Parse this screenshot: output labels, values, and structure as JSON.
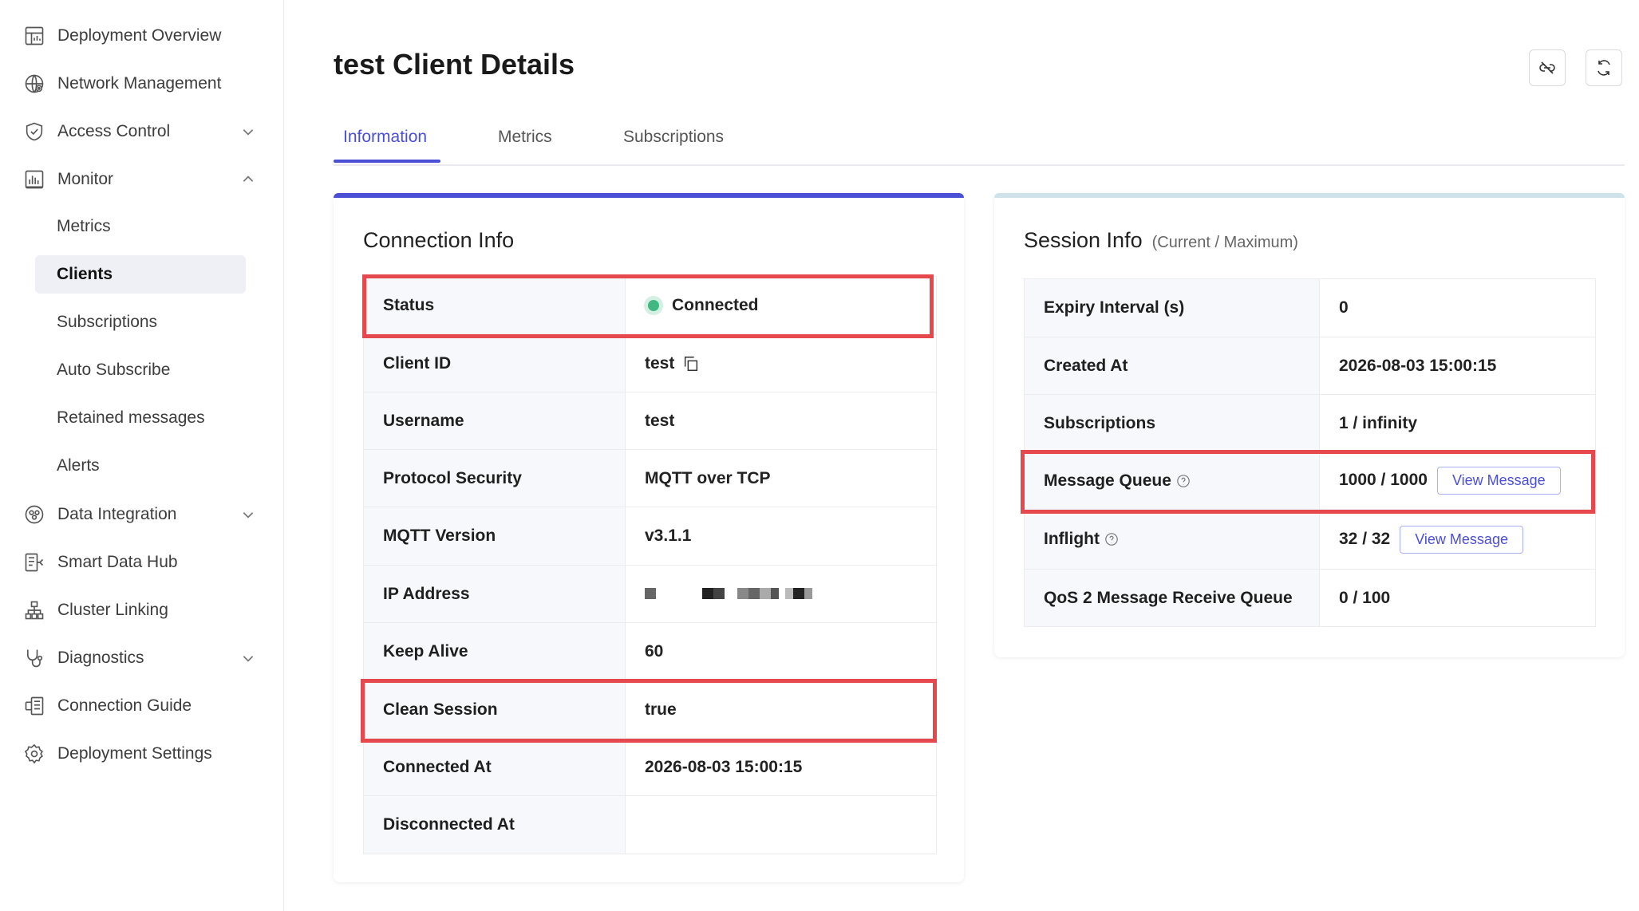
{
  "sidebar": {
    "items": [
      {
        "label": "Deployment Overview",
        "icon": "dashboard-icon"
      },
      {
        "label": "Network Management",
        "icon": "globe-icon"
      },
      {
        "label": "Access Control",
        "icon": "shield-icon"
      },
      {
        "label": "Monitor",
        "icon": "bar-chart-icon"
      },
      {
        "label": "Data Integration",
        "icon": "integration-icon"
      },
      {
        "label": "Smart Data Hub",
        "icon": "data-hub-icon"
      },
      {
        "label": "Cluster Linking",
        "icon": "cluster-icon"
      },
      {
        "label": "Diagnostics",
        "icon": "stethoscope-icon"
      },
      {
        "label": "Connection Guide",
        "icon": "guide-icon"
      },
      {
        "label": "Deployment Settings",
        "icon": "gear-icon"
      }
    ],
    "monitor_sub": [
      "Metrics",
      "Clients",
      "Subscriptions",
      "Auto Subscribe",
      "Retained messages",
      "Alerts"
    ],
    "active_sub": "Clients"
  },
  "header": {
    "title": "test Client Details"
  },
  "tabs": [
    "Information",
    "Metrics",
    "Subscriptions"
  ],
  "active_tab": "Information",
  "accent_color": "#4b4fd6",
  "highlight_color": "#e5484d",
  "connection": {
    "title": "Connection Info",
    "rows": [
      {
        "label": "Status",
        "value": "Connected"
      },
      {
        "label": "Client ID",
        "value": "test"
      },
      {
        "label": "Username",
        "value": "test"
      },
      {
        "label": "Protocol Security",
        "value": "MQTT over TCP"
      },
      {
        "label": "MQTT Version",
        "value": "v3.1.1"
      },
      {
        "label": "IP Address",
        "value": ""
      },
      {
        "label": "Keep Alive",
        "value": "60"
      },
      {
        "label": "Clean Session",
        "value": "true"
      },
      {
        "label": "Connected At",
        "value": "2026-08-03 15:00:15"
      },
      {
        "label": "Disconnected At",
        "value": ""
      }
    ]
  },
  "session": {
    "title": "Session Info",
    "subtitle": "(Current / Maximum)",
    "view_message_label": "View Message",
    "rows": [
      {
        "label": "Expiry Interval (s)",
        "value": "0"
      },
      {
        "label": "Created At",
        "value": "2026-08-03 15:00:15"
      },
      {
        "label": "Subscriptions",
        "value": "1 / infinity"
      },
      {
        "label": "Message Queue",
        "value": "1000 / 1000"
      },
      {
        "label": "Inflight",
        "value": "32 / 32"
      },
      {
        "label": "QoS 2 Message Receive Queue",
        "value": "0 / 100"
      }
    ]
  }
}
